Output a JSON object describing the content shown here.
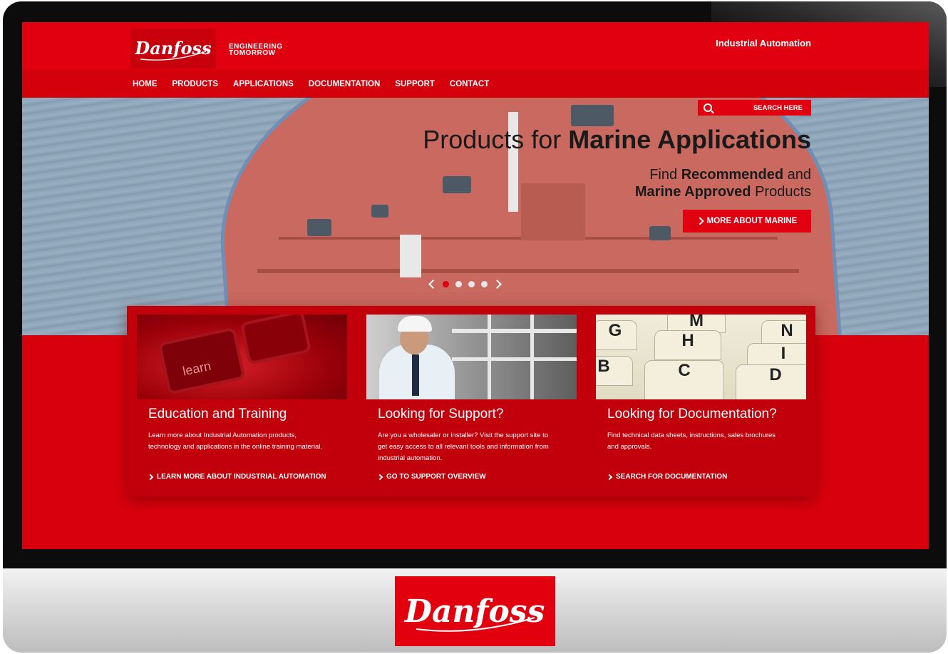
{
  "header": {
    "brand": "Danfoss",
    "tagline_line1": "ENGINEERING",
    "tagline_line2": "TOMORROW",
    "region": "Industrial Automation"
  },
  "nav": {
    "items": [
      {
        "label": "HOME"
      },
      {
        "label": "PRODUCTS"
      },
      {
        "label": "APPLICATIONS"
      },
      {
        "label": "DOCUMENTATION"
      },
      {
        "label": "SUPPORT"
      },
      {
        "label": "CONTACT"
      }
    ]
  },
  "search": {
    "placeholder": "SEARCH HERE",
    "icon": "search-icon"
  },
  "hero": {
    "title_light": "Products for ",
    "title_bold": "Marine Applications",
    "sub_line1_a": "Find ",
    "sub_line1_b": "Recommended",
    "sub_line1_c": " and",
    "sub_line2_a": "Marine Approved",
    "sub_line2_b": " Products",
    "cta": "MORE ABOUT MARINE",
    "slides": 4,
    "active_slide": 1
  },
  "cards": [
    {
      "image_text": "learn",
      "title": "Education and Training",
      "body": "Learn more about Industrial Automation products, technology and applications in the online training material.",
      "link": "LEARN MORE ABOUT INDUSTRIAL AUTOMATION"
    },
    {
      "title": "Looking for Support?",
      "body": "Are you a wholesaler or installer? Visit the support site to get easy access to all relevant tools and information from industrial automation.",
      "link": "GO TO SUPPORT OVERVIEW"
    },
    {
      "image_tabs": [
        "G",
        "M",
        "N",
        "H",
        "I",
        "C",
        "D",
        "B"
      ],
      "title": "Looking for Documentation?",
      "body": "Find technical data sheets, instructions, sales brochures and approvals.",
      "link": "SEARCH FOR DOCUMENTATION"
    }
  ],
  "monitor": {
    "chin_logo": "Danfoss"
  },
  "colors": {
    "brand_red": "#e1000f",
    "dark_red": "#c2000b",
    "text_dark": "#1a1a1a"
  }
}
